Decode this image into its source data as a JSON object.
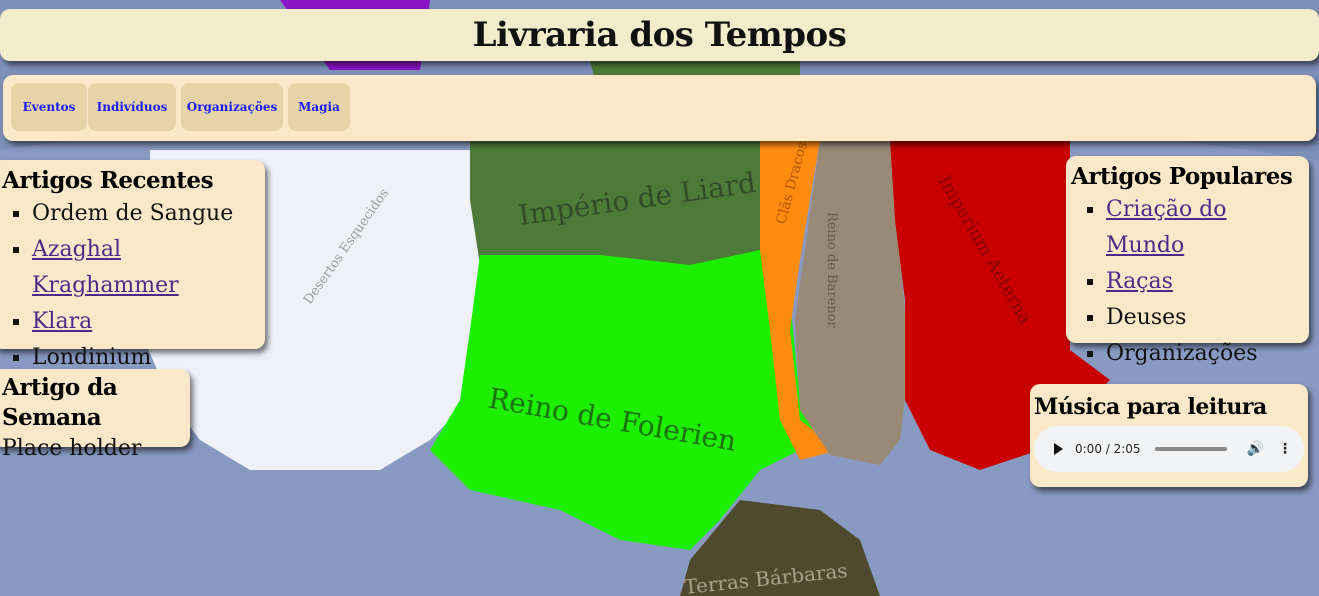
{
  "header": {
    "title": "Livraria dos Tempos"
  },
  "nav": {
    "items": [
      {
        "label": "Eventos"
      },
      {
        "label": "Indivíduos"
      },
      {
        "label": "Organizações"
      },
      {
        "label": "Magia"
      }
    ]
  },
  "map": {
    "regions": {
      "empire_liard": "Império de Liard",
      "folerien": "Reino de Folerien",
      "desertos": "Desertos Esquecidos",
      "clas": "Clãs Dracos",
      "barenor": "Reino de Barenor",
      "aeterna": "Imperium Aeterna",
      "barbaras": "Terras Bárbaras"
    }
  },
  "recent": {
    "title": "Artigos Recentes",
    "items": [
      "Ordem de Sangue",
      "Azaghal Kraghammer",
      "Klara",
      "Londinium"
    ]
  },
  "week": {
    "title": "Artigo da Semana",
    "body": "Place holder"
  },
  "popular": {
    "title": "Artigos Populares",
    "items": [
      "Criação do Mundo",
      "Raças",
      "Deuses",
      "Organizações"
    ]
  },
  "music": {
    "title": "Música para leitura",
    "time": "0:00 / 2:05"
  }
}
